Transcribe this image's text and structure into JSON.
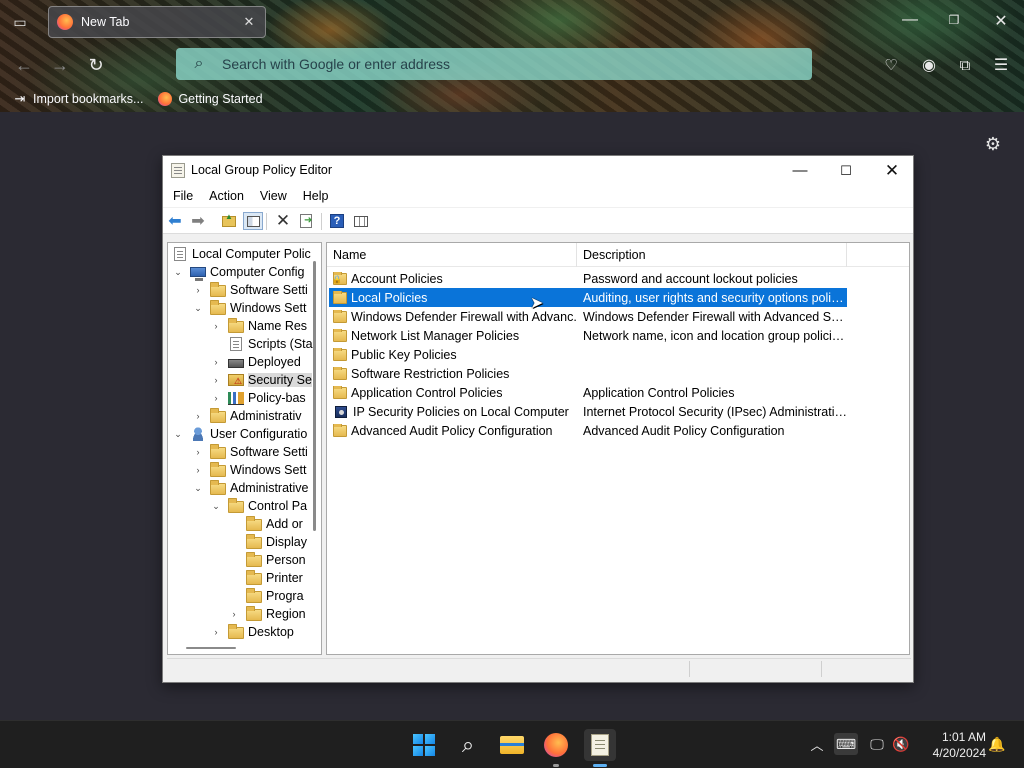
{
  "browser": {
    "tab_title": "New Tab",
    "tab_close": "✕",
    "url_placeholder": "Search with Google or enter address",
    "bookmarks": [
      "Import bookmarks...",
      "Getting Started"
    ]
  },
  "gpedit": {
    "title": "Local Group Policy Editor",
    "menu": [
      "File",
      "Action",
      "View",
      "Help"
    ],
    "tree": [
      {
        "label": "Local Computer Polic",
        "depth": 0,
        "expander": "",
        "icon": "doc"
      },
      {
        "label": "Computer Config",
        "depth": 0,
        "expander": "⌄",
        "icon": "computer"
      },
      {
        "label": "Software Setti",
        "depth": 1,
        "expander": "›",
        "icon": "folder"
      },
      {
        "label": "Windows Sett",
        "depth": 1,
        "expander": "⌄",
        "icon": "folder"
      },
      {
        "label": "Name Res",
        "depth": 2,
        "expander": "›",
        "icon": "folder"
      },
      {
        "label": "Scripts (Sta",
        "depth": 2,
        "expander": "",
        "icon": "doc"
      },
      {
        "label": "Deployed",
        "depth": 2,
        "expander": "›",
        "icon": "printer"
      },
      {
        "label": "Security Se",
        "depth": 2,
        "expander": "›",
        "icon": "security"
      },
      {
        "label": "Policy-bas",
        "depth": 2,
        "expander": "›",
        "icon": "chart"
      },
      {
        "label": "Administrativ",
        "depth": 1,
        "expander": "›",
        "icon": "folder"
      },
      {
        "label": "User Configuratio",
        "depth": 0,
        "expander": "⌄",
        "icon": "user"
      },
      {
        "label": "Software Setti",
        "depth": 1,
        "expander": "›",
        "icon": "folder"
      },
      {
        "label": "Windows Sett",
        "depth": 1,
        "expander": "›",
        "icon": "folder"
      },
      {
        "label": "Administrative",
        "depth": 1,
        "expander": "⌄",
        "icon": "folder"
      },
      {
        "label": "Control Pa",
        "depth": 2,
        "expander": "⌄",
        "icon": "folder"
      },
      {
        "label": "Add or",
        "depth": 3,
        "expander": "",
        "icon": "folder"
      },
      {
        "label": "Display",
        "depth": 3,
        "expander": "",
        "icon": "folder"
      },
      {
        "label": "Person",
        "depth": 3,
        "expander": "",
        "icon": "folder"
      },
      {
        "label": "Printer",
        "depth": 3,
        "expander": "",
        "icon": "folder"
      },
      {
        "label": "Progra",
        "depth": 3,
        "expander": "",
        "icon": "folder"
      },
      {
        "label": "Region",
        "depth": 3,
        "expander": "›",
        "icon": "folder"
      },
      {
        "label": "Desktop",
        "depth": 2,
        "expander": "›",
        "icon": "folder"
      }
    ],
    "selected_tree_item": "Security Se",
    "columns": {
      "name": "Name",
      "description": "Description"
    },
    "items": [
      {
        "name": "Account Policies",
        "description": "Password and account lockout policies",
        "icon": "lock-folder"
      },
      {
        "name": "Local Policies",
        "description": "Auditing, user rights and security options polici...",
        "icon": "folder"
      },
      {
        "name": "Windows Defender Firewall with Advanc...",
        "description": "Windows Defender Firewall with Advanced Sec...",
        "icon": "folder"
      },
      {
        "name": "Network List Manager Policies",
        "description": "Network name, icon and location group policies.",
        "icon": "folder"
      },
      {
        "name": "Public Key Policies",
        "description": "",
        "icon": "folder"
      },
      {
        "name": "Software Restriction Policies",
        "description": "",
        "icon": "folder"
      },
      {
        "name": "Application Control Policies",
        "description": "Application Control Policies",
        "icon": "folder"
      },
      {
        "name": "IP Security Policies on Local Computer",
        "description": "Internet Protocol Security (IPsec) Administratio...",
        "icon": "ipsec"
      },
      {
        "name": "Advanced Audit Policy Configuration",
        "description": "Advanced Audit Policy Configuration",
        "icon": "folder"
      }
    ],
    "selected_item": "Local Policies"
  },
  "taskbar": {
    "time": "1:01 AM",
    "date": "4/20/2024"
  },
  "colors": {
    "selection": "#0a74d9",
    "taskbar": "#1f1f1f",
    "urlbar": "#8ad6c8"
  }
}
